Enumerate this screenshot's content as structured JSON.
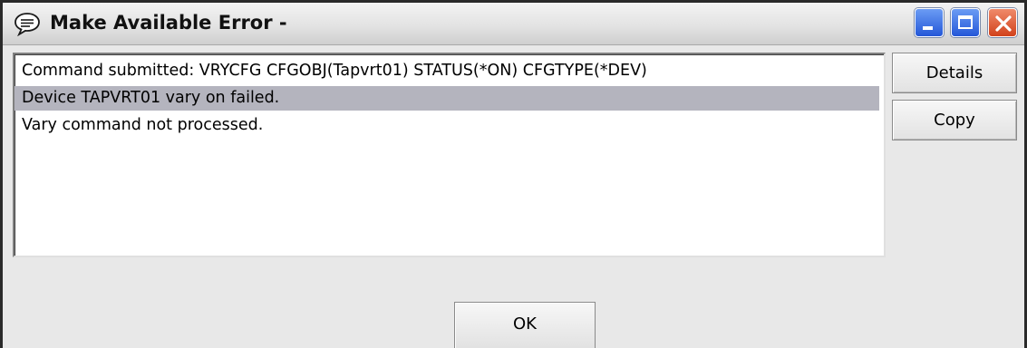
{
  "window": {
    "title": "Make Available Error -",
    "title_icon": "speech-bubble-icon",
    "controls": {
      "minimize_icon": "minimize-icon",
      "maximize_icon": "maximize-icon",
      "close_icon": "close-icon"
    }
  },
  "messages": [
    "Command submitted: VRYCFG CFGOBJ(Tapvrt01) STATUS(*ON) CFGTYPE(*DEV)",
    "Device TAPVRT01 vary on failed.",
    "Vary command not processed."
  ],
  "selected_message_index": 1,
  "buttons": {
    "details": "Details",
    "copy": "Copy",
    "ok": "OK"
  },
  "colors": {
    "selection": "#b4b4be",
    "close_button": "#d2421c",
    "window_button": "#2457d8"
  }
}
